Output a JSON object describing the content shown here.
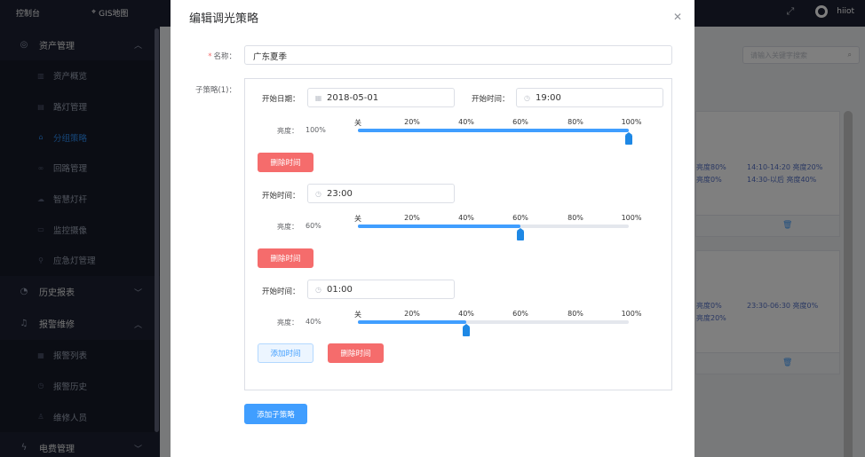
{
  "sidebar": {
    "top_label": "控制台",
    "gis_label": "GIS地图",
    "groups": [
      {
        "label": "资产管理",
        "items": [
          "资产概览",
          "路灯管理",
          "分组策略",
          "回路管理",
          "智慧灯杆",
          "监控摄像",
          "应急灯管理"
        ]
      },
      {
        "label": "历史报表"
      },
      {
        "label": "报警维修",
        "items": [
          "报警列表",
          "报警历史",
          "维修人员"
        ]
      },
      {
        "label": "电费管理"
      }
    ]
  },
  "topbar": {
    "username": "hiiot"
  },
  "background": {
    "search_placeholder": "请输入关键字搜索",
    "card1": {
      "lines": [
        "亮度80%",
        "亮度0%"
      ],
      "lines2": [
        "14:10-14:20 亮度20%",
        "14:30-以后 亮度40%"
      ]
    },
    "card2": {
      "lines": [
        "亮度0%",
        "亮度20%"
      ],
      "lines2": [
        "23:30-06:30 亮度0%"
      ]
    }
  },
  "dialog": {
    "title": "编辑调光策略",
    "name_label": "名称：",
    "name_value": "广东夏季",
    "substrategy_label": "子策略(1)：",
    "start_date_label": "开始日期：",
    "start_date_value": "2018-05-01",
    "start_time_label": "开始时间：",
    "brightness_label": "亮度：",
    "ticks": [
      "关",
      "20%",
      "40%",
      "60%",
      "80%",
      "100%"
    ],
    "time_slots": [
      {
        "time": "19:00",
        "brightness": 100,
        "brightness_text": "100%"
      },
      {
        "time": "23:00",
        "brightness": 60,
        "brightness_text": "60%"
      },
      {
        "time": "01:00",
        "brightness": 40,
        "brightness_text": "40%"
      }
    ],
    "delete_time_label": "删除时间",
    "add_time_label": "添加时间",
    "add_substrategy_label": "添加子策略"
  },
  "colors": {
    "primary": "#409eff",
    "danger": "#f56c6c",
    "sidebar_bg": "#1d2133",
    "active": "#2d8cf0"
  }
}
